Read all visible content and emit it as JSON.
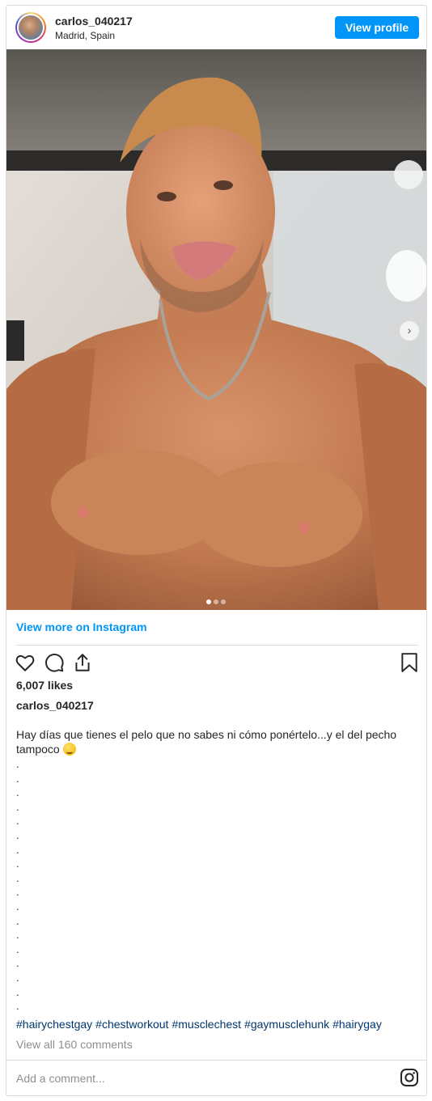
{
  "header": {
    "username": "carlos_040217",
    "location": "Madrid, Spain",
    "view_profile_label": "View profile"
  },
  "photo": {
    "carousel_total": 3,
    "carousel_active": 1,
    "next_arrow": "›",
    "description_alt": ""
  },
  "links": {
    "view_more_label": "View more on Instagram"
  },
  "actions": {
    "icons": [
      "heart-icon",
      "comment-icon",
      "share-icon",
      "bookmark-icon"
    ]
  },
  "post": {
    "likes": "6,007 likes",
    "caption_username": "carlos_040217",
    "caption_text": "Hay días que tienes el pelo que no sabes ni cómo ponértelo...y el del pecho tampoco",
    "dots": [
      ".",
      ".",
      ".",
      ".",
      ".",
      ".",
      ".",
      ".",
      ".",
      ".",
      ".",
      ".",
      ".",
      ".",
      ".",
      ".",
      ".",
      "."
    ],
    "hashtags": [
      "#hairychestgay",
      "#chestworkout",
      "#musclechest",
      "#gaymusclehunk",
      "#hairygay"
    ],
    "view_comments": "View all 160 comments"
  },
  "footer": {
    "add_comment_placeholder": "Add a comment...",
    "instagram_icon": "instagram-icon"
  },
  "colors": {
    "accent": "#0095f6",
    "hashtag": "#00376b",
    "muted": "#8e8e8e",
    "border": "#dbdbdb"
  }
}
